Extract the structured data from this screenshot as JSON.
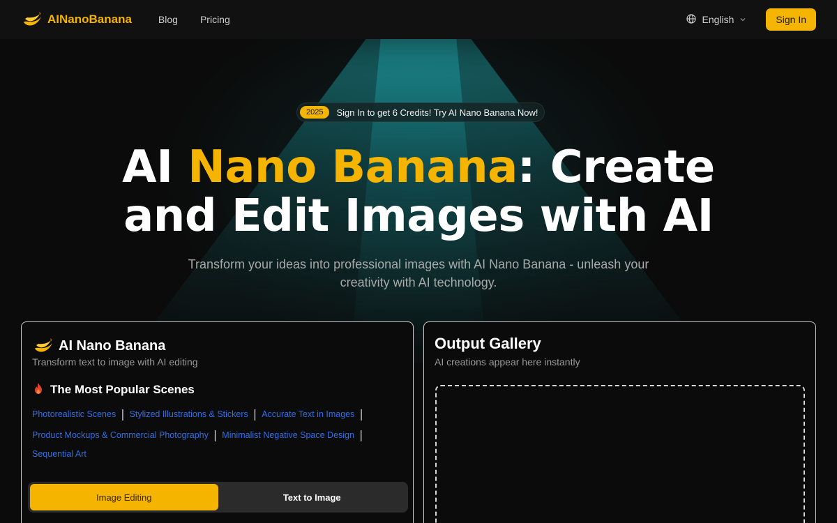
{
  "header": {
    "brand": "AINanoBanana",
    "nav": [
      "Blog",
      "Pricing"
    ],
    "language": "English",
    "signin_label": "Sign In"
  },
  "hero": {
    "badge_year": "2025",
    "badge_text": "Sign In to get 6 Credits! Try AI Nano Banana Now!",
    "title_prefix": "AI ",
    "title_accent": "Nano Banana",
    "title_line1_suffix": ": Create",
    "title_line2": "and Edit Images with AI",
    "subtitle": "Transform your ideas into professional images with AI Nano Banana - unleash your creativity with AI technology."
  },
  "editor": {
    "title": "AI Nano Banana",
    "subtitle": "Transform text to image with AI editing",
    "scenes_heading": "The Most Popular Scenes",
    "scenes": [
      "Photorealistic Scenes",
      "Stylized Illustrations & Stickers",
      "Accurate Text in Images",
      "Product Mockups & Commercial Photography",
      "Minimalist Negative Space Design",
      "Sequential Art"
    ],
    "modes": [
      "Image Editing",
      "Text to Image"
    ],
    "active_mode": "Image Editing"
  },
  "gallery": {
    "title": "Output Gallery",
    "subtitle": "AI creations appear here instantly"
  },
  "colors": {
    "accent": "#f4b400",
    "link": "#2f6ee8",
    "background": "#0b0b0b"
  },
  "icons": [
    "banana-icon",
    "globe-icon",
    "chevron-down-icon",
    "fire-icon"
  ]
}
